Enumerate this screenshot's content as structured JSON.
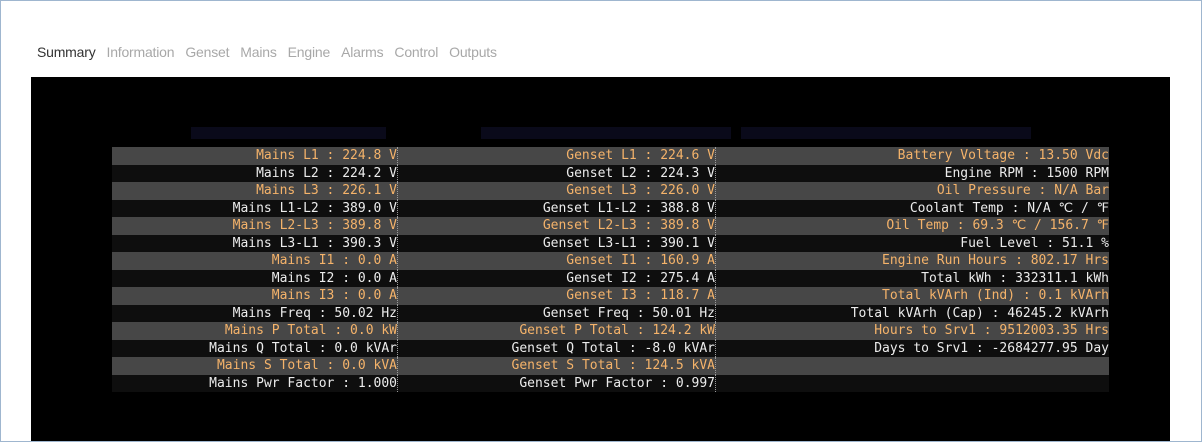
{
  "tabs": [
    {
      "label": "Summary",
      "active": true
    },
    {
      "label": "Information",
      "active": false
    },
    {
      "label": "Genset",
      "active": false
    },
    {
      "label": "Mains",
      "active": false
    },
    {
      "label": "Engine",
      "active": false
    },
    {
      "label": "Alarms",
      "active": false
    },
    {
      "label": "Control",
      "active": false
    },
    {
      "label": "Outputs",
      "active": false
    }
  ],
  "colors": {
    "highlight_text": "#f5b36a",
    "normal_text": "#ececec",
    "stripe_row": "#474747",
    "screen_background": "#000000"
  },
  "rows": [
    {
      "mains": "Mains L1 : 224.8 V",
      "genset": "Genset L1 : 224.6 V",
      "engine": "Battery Voltage : 13.50 Vdc",
      "highlight": true
    },
    {
      "mains": "Mains L2 : 224.2 V",
      "genset": "Genset L2 : 224.3 V",
      "engine": "Engine RPM : 1500 RPM",
      "highlight": false
    },
    {
      "mains": "Mains L3 : 226.1 V",
      "genset": "Genset L3 : 226.0 V",
      "engine": "Oil Pressure : N/A Bar",
      "highlight": true
    },
    {
      "mains": "Mains L1-L2 : 389.0 V",
      "genset": "Genset L1-L2 : 388.8 V",
      "engine": "Coolant Temp : N/A ℃ / ℉",
      "highlight": false
    },
    {
      "mains": "Mains L2-L3 : 389.8 V",
      "genset": "Genset L2-L3 : 389.8 V",
      "engine": "Oil Temp : 69.3 ℃ / 156.7 ℉",
      "highlight": true
    },
    {
      "mains": "Mains L3-L1 : 390.3 V",
      "genset": "Genset L3-L1 : 390.1 V",
      "engine": "Fuel Level : 51.1 %",
      "highlight": false
    },
    {
      "mains": "Mains I1 : 0.0 A",
      "genset": "Genset I1 : 160.9 A",
      "engine": "Engine Run Hours : 802.17 Hrs",
      "highlight": true
    },
    {
      "mains": "Mains I2 : 0.0 A",
      "genset": "Genset I2 : 275.4 A",
      "engine": "Total kWh : 332311.1 kWh",
      "highlight": false
    },
    {
      "mains": "Mains I3 : 0.0 A",
      "genset": "Genset I3 : 118.7 A",
      "engine": "Total kVArh (Ind) : 0.1 kVArh",
      "highlight": true
    },
    {
      "mains": "Mains Freq : 50.02 Hz",
      "genset": "Genset Freq : 50.01 Hz",
      "engine": "Total kVArh (Cap) : 46245.2 kVArh",
      "highlight": false
    },
    {
      "mains": "Mains P Total : 0.0 kW",
      "genset": "Genset P Total : 124.2 kW",
      "engine": "Hours to Srv1 : 9512003.35 Hrs",
      "highlight": true
    },
    {
      "mains": "Mains Q Total : 0.0 kVAr",
      "genset": "Genset Q Total : -8.0 kVAr",
      "engine": "Days to Srv1 : -2684277.95 Day",
      "highlight": false
    },
    {
      "mains": "Mains S Total : 0.0 kVA",
      "genset": "Genset S Total : 124.5 kVA",
      "engine": "",
      "highlight": true
    },
    {
      "mains": "Mains Pwr Factor : 1.000",
      "genset": "Genset Pwr Factor : 0.997",
      "engine": "",
      "highlight": false
    }
  ]
}
